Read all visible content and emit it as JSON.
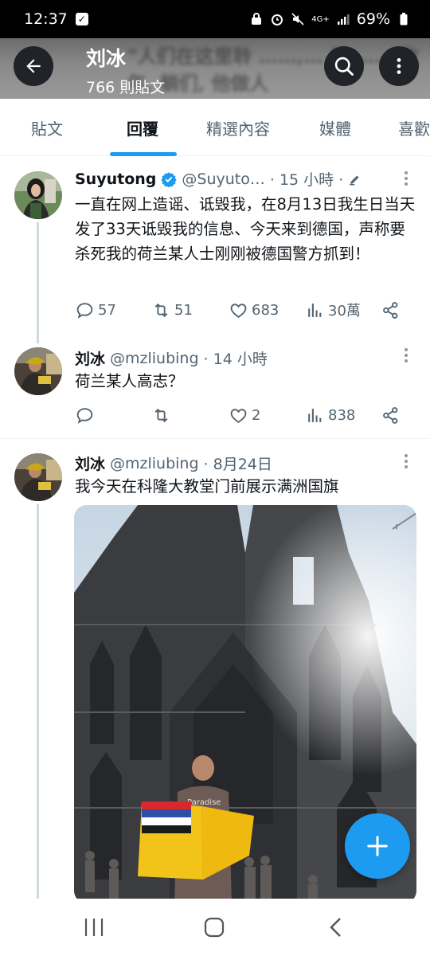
{
  "status_bar": {
    "time": "12:37",
    "network": "4G+",
    "battery": "69%"
  },
  "header": {
    "name": "刘冰",
    "post_count": "766 則貼文",
    "background_text": "\"人们在这里聆 ……,… 日 …… 数年, 躺们, 他做人"
  },
  "tabs": [
    {
      "label": "貼文"
    },
    {
      "label": "回覆"
    },
    {
      "label": "精選內容"
    },
    {
      "label": "媒體"
    },
    {
      "label": "喜歡"
    }
  ],
  "active_tab": "回覆",
  "tweets": [
    {
      "name": "Suyutong",
      "verified": true,
      "handle": "@Suyuto…",
      "time": "· 15 小時 ·",
      "text": "一直在网上造谣、诋毁我，在8月13日我生日当天发了33天诋毁我的信息、今天来到德国，声称要杀死我的荷兰某人士刚刚被德国警方抓到！",
      "replies": "57",
      "retweets": "51",
      "likes": "683",
      "views": "30萬"
    },
    {
      "name": "刘冰",
      "handle": "@mzliubing",
      "time": "· 14 小時",
      "text": "荷兰某人高志？",
      "replies": "",
      "retweets": "",
      "likes": "2",
      "views": "838"
    },
    {
      "name": "刘冰",
      "handle": "@mzliubing",
      "time": "· 8月24日",
      "text": "我今天在科隆大教堂门前展示满洲国旗",
      "photo_caption": "Paradise Beach"
    }
  ],
  "colors": {
    "accent": "#1d9bf0",
    "text": "#0f1419",
    "secondary": "#536471"
  },
  "icons": [
    "back-arrow-icon",
    "search-icon",
    "more-vertical-icon",
    "verified-badge-icon",
    "edit-pencil-icon",
    "reply-icon",
    "retweet-icon",
    "like-icon",
    "views-icon",
    "share-icon",
    "compose-plus-icon"
  ]
}
